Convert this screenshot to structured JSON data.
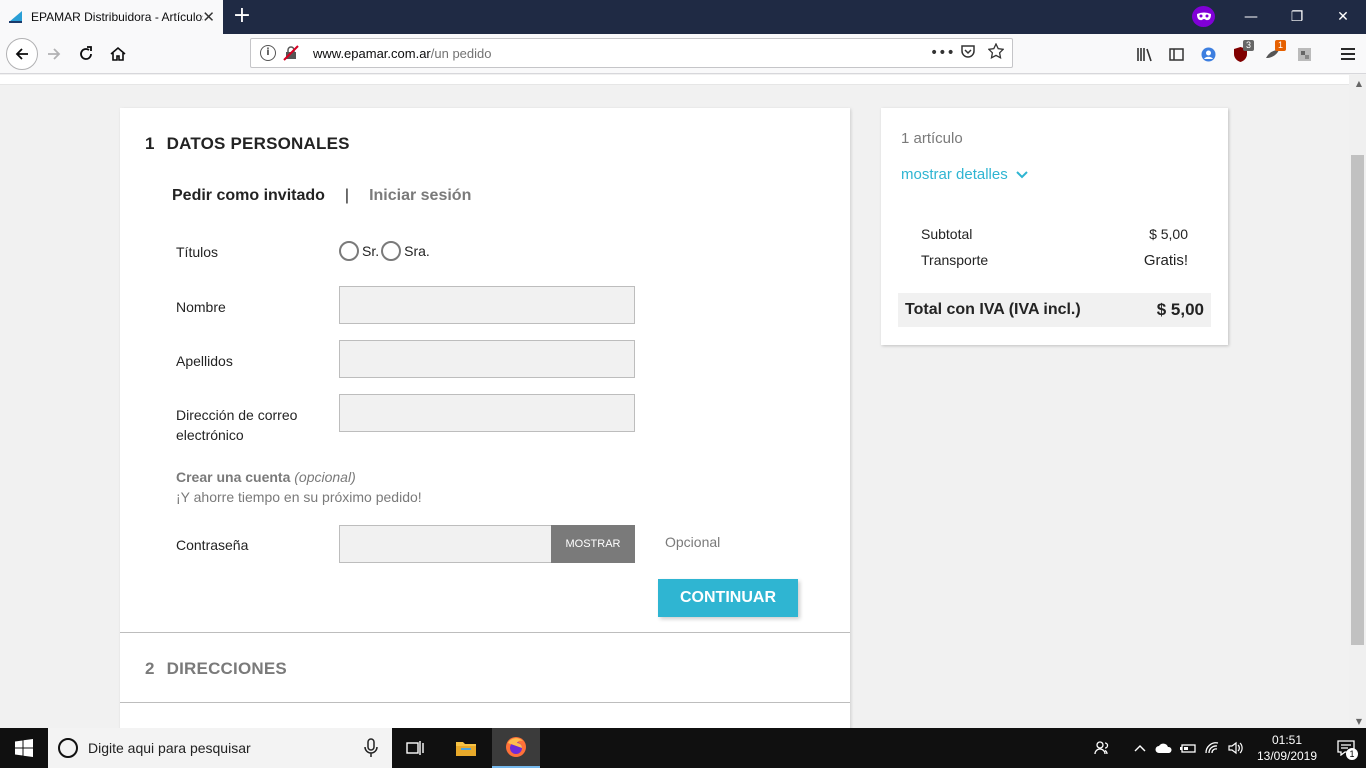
{
  "browser": {
    "tab_title": "EPAMAR Distribuidora - Artículos",
    "tab_close": "✕",
    "new_tab": "+",
    "url_domain": "www.epamar.com.ar",
    "url_path": "/un pedido",
    "badge_ublock": "3",
    "badge_addon": "1",
    "window_minimize": "—",
    "window_restore": "❐",
    "window_close": "✕"
  },
  "checkout": {
    "step1": {
      "number": "1",
      "title": "DATOS PERSONALES"
    },
    "guest_tab": "Pedir como invitado",
    "separator": "|",
    "login_tab": "Iniciar sesión",
    "titles_label": "Títulos",
    "title_options": [
      "Sr.",
      "Sra."
    ],
    "name_label": "Nombre",
    "lastname_label": "Apellidos",
    "email_label_line1": "Dirección de correo",
    "email_label_line2": "electrónico",
    "create_account": "Crear una cuenta",
    "create_account_optional": "(opcional)",
    "create_account_sub": "¡Y ahorre tiempo en su próximo pedido!",
    "password_label": "Contraseña",
    "show_button": "MOSTRAR",
    "password_optional": "Opcional",
    "continue_button": "CONTINUAR",
    "step2": {
      "number": "2",
      "title": "DIRECCIONES"
    }
  },
  "summary": {
    "items_count": "1 artículo",
    "show_details": "mostrar detalles",
    "subtotal_label": "Subtotal",
    "subtotal_value": "$ 5,00",
    "shipping_label": "Transporte",
    "shipping_value": "Gratis!",
    "total_label": "Total con IVA (IVA incl.)",
    "total_value": "$ 5,00"
  },
  "taskbar": {
    "search_placeholder": "Digite aqui para pesquisar",
    "time": "01:51",
    "date": "13/09/2019",
    "notification_count": "1"
  },
  "colors": {
    "accent": "#2fb5d2",
    "titlebar": "#1f2a44",
    "private": "#8000d7"
  }
}
